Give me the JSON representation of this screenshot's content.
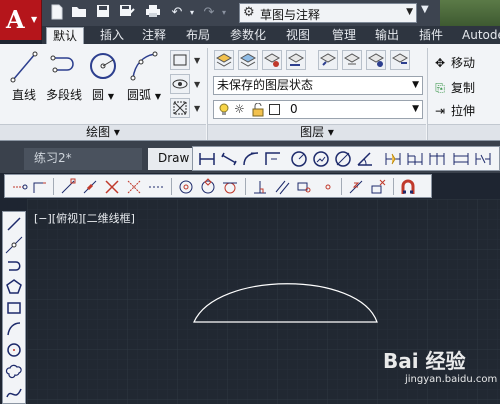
{
  "app": {
    "logo": "A"
  },
  "workspace": {
    "label": "草图与注释"
  },
  "tabs": [
    "默认",
    "插入",
    "注释",
    "布局",
    "参数化",
    "视图",
    "管理",
    "输出",
    "插件",
    "Autodes"
  ],
  "draw_panel": {
    "tools": [
      "直线",
      "多段线",
      "圆",
      "圆弧"
    ],
    "title": "绘图 ▾"
  },
  "layers_panel": {
    "layer_state": "未保存的图层状态",
    "current_layer": "0",
    "title": "图层 ▾"
  },
  "modify_panel": {
    "items": [
      "移动",
      "复制",
      "拉伸"
    ]
  },
  "doc_tabs": {
    "inactive": "练习2*",
    "active": "Draw"
  },
  "viewport": {
    "label": "[−][俯视][二维线框]"
  },
  "watermark": {
    "main": "Bai 经验",
    "sub": "jingyan.baidu.com"
  },
  "colors": {
    "app_red": "#b5151b",
    "canvas": "#212832",
    "ribbon": "#f2f4f7"
  }
}
